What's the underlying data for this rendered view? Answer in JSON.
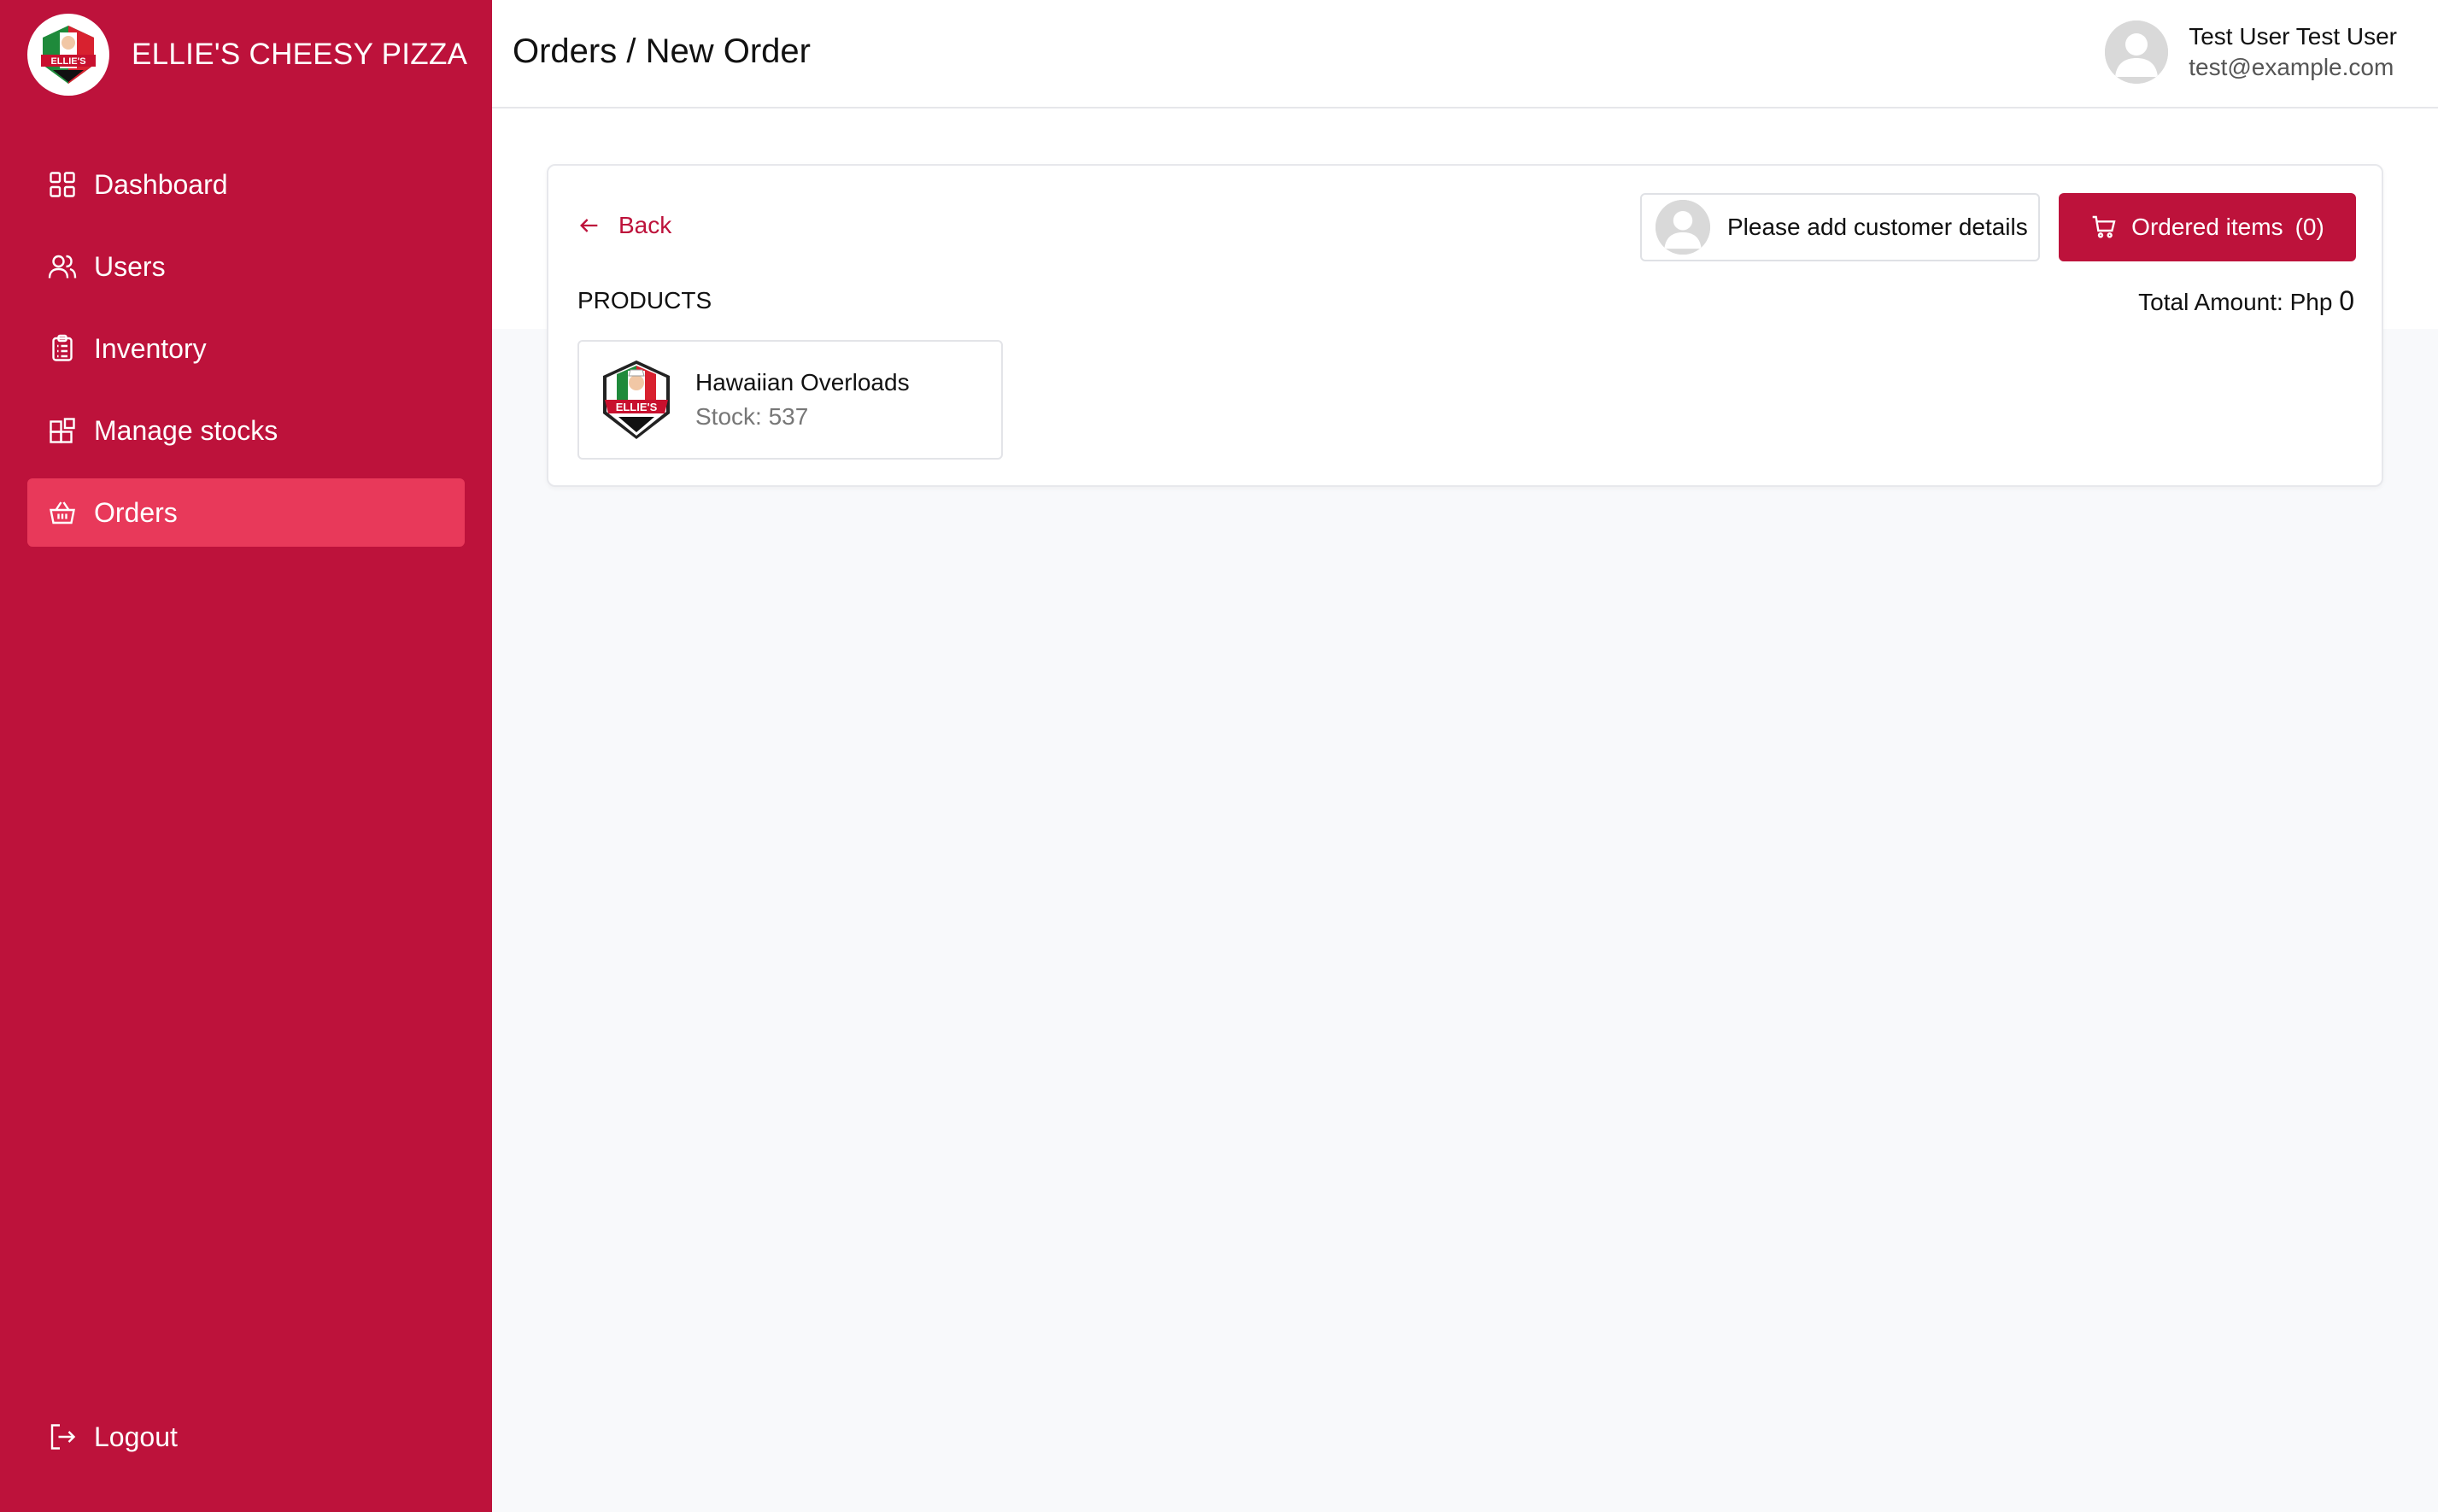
{
  "brand": {
    "name": "ELLIE'S CHEESY PIZZA",
    "logo_text": "ELLIE'S"
  },
  "colors": {
    "primary": "#bd123b",
    "active_nav": "#e8395a"
  },
  "sidebar": {
    "items": [
      {
        "label": "Dashboard",
        "icon": "grid-icon"
      },
      {
        "label": "Users",
        "icon": "users-icon"
      },
      {
        "label": "Inventory",
        "icon": "clipboard-icon"
      },
      {
        "label": "Manage stocks",
        "icon": "blocks-icon"
      },
      {
        "label": "Orders",
        "icon": "basket-icon",
        "active": true
      }
    ],
    "logout_label": "Logout"
  },
  "header": {
    "title": "Orders / New Order",
    "user_name": "Test User Test User",
    "user_email": "test@example.com"
  },
  "order": {
    "back_label": "Back",
    "customer_button_label": "Please add customer details",
    "ordered_items_label": "Ordered items",
    "ordered_items_count": "(0)",
    "products_label": "PRODUCTS",
    "total_label": "Total Amount: Php",
    "total_value": "0"
  },
  "products": [
    {
      "name": "Hawaiian Overloads",
      "stock": "Stock: 537",
      "logo_text": "ELLIE'S"
    }
  ]
}
